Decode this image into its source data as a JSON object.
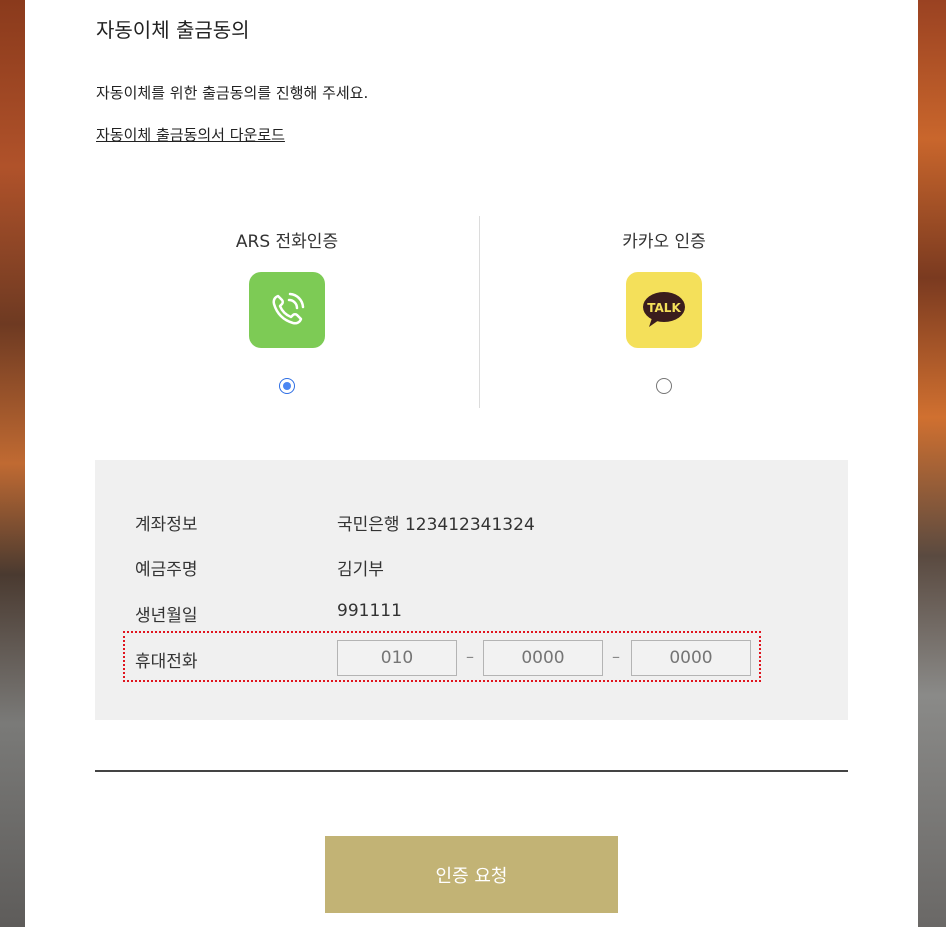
{
  "page": {
    "title": "자동이체 출금동의",
    "description": "자동이체를 위한 출금동의를 진행해 주세요.",
    "download_link": "자동이체 출금동의서 다운로드"
  },
  "auth_methods": [
    {
      "label": "ARS 전화인증",
      "icon": "phone-call-icon",
      "color": "#7dcb55",
      "selected": true
    },
    {
      "label": "카카오 인증",
      "icon": "kakao-talk-icon",
      "icon_text": "TALK",
      "color": "#f4e05a",
      "selected": false
    }
  ],
  "account_info": {
    "account_label": "계좌정보",
    "account_value": "국민은행 123412341324",
    "holder_label": "예금주명",
    "holder_value": "김기부",
    "birth_label": "생년월일",
    "birth_value": "991111",
    "phone_label": "휴대전화",
    "phone_part1_placeholder": "010",
    "phone_part2_placeholder": "0000",
    "phone_part3_placeholder": "0000",
    "phone_separator": "–"
  },
  "submit_button": {
    "label": "인증 요청",
    "color": "#c2b375"
  }
}
